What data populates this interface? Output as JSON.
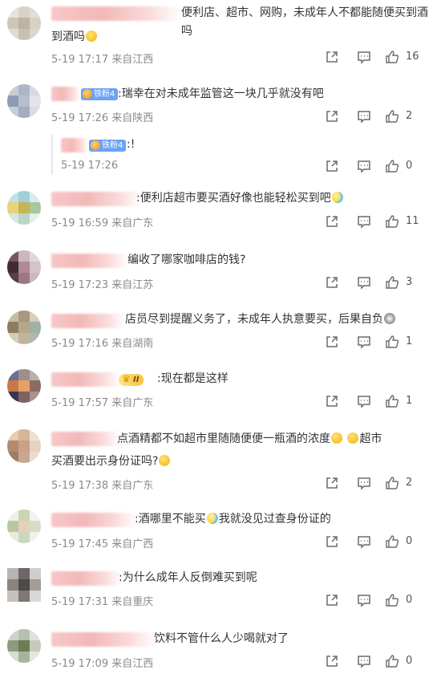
{
  "comments": [
    {
      "text": "便利店、超市、网购，未成年人不都能随便买到酒吗",
      "emoji": "em",
      "badge": "",
      "time": "5-19 17:17",
      "loc": "来自江西",
      "likes": "16"
    },
    {
      "text": ":瑞幸在对未成年监管这一块几乎就没有吧",
      "badge": "铁粉4",
      "time": "5-19 17:26",
      "loc": "来自陕西",
      "likes": "2"
    },
    {
      "text": ":!",
      "badge": "铁粉4",
      "time": "5-19 17:26",
      "loc": "",
      "likes": "0"
    },
    {
      "text": ":便利店超市要买酒好像也能轻松买到吧",
      "emoji": "cry",
      "time": "5-19 16:59",
      "loc": "来自广东",
      "likes": "11"
    },
    {
      "text": "编收了哪家咖啡店的钱?",
      "time": "5-19 17:23",
      "loc": "来自江苏",
      "likes": "3"
    },
    {
      "text": "店员尽到提醒义务了，未成年人执意要买，后果自负",
      "emoji": "em",
      "time": "5-19 17:16",
      "loc": "来自湖南",
      "likes": "1"
    },
    {
      "text": ":现在都是这样",
      "vip": "II",
      "time": "5-19 17:57",
      "loc": "来自广东",
      "likes": "1"
    },
    {
      "text": "点酒精都不如超市里随随便便一瓶酒的浓度",
      "text2": "超市",
      "text3": "买酒要出示身份证吗?",
      "time": "5-19 17:38",
      "loc": "来自广东",
      "likes": "2"
    },
    {
      "text": ":酒哪里不能买",
      "text2": "我就没见过查身份证的",
      "time": "5-19 17:45",
      "loc": "来自广西",
      "likes": "0"
    },
    {
      "text": ":为什么成年人反倒难买到呢",
      "time": "5-19 17:31",
      "loc": "来自重庆",
      "likes": "0"
    },
    {
      "text": "饮料不管什么人少喝就对了",
      "time": "5-19 17:09",
      "loc": "来自江西",
      "likes": "0"
    }
  ],
  "colors": {
    "text": "#333333",
    "meta": "#8a8a8a",
    "icon": "#6b6b6b",
    "badge": "#6aa3f5"
  },
  "icons": [
    "share-icon",
    "comment-icon",
    "like-icon"
  ]
}
